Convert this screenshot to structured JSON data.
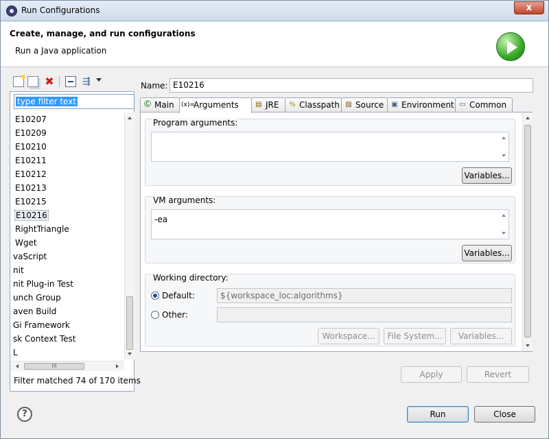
{
  "window": {
    "title": "Run Configurations",
    "close_label": "x"
  },
  "header": {
    "title": "Create, manage, and run configurations",
    "subtitle": "Run a Java application",
    "badge_icon": "run-play-icon"
  },
  "left": {
    "toolbar_icons": [
      "new-config-icon",
      "duplicate-config-icon",
      "delete-config-icon",
      "collapse-all-icon",
      "filter-icon",
      "dropdown-arrow-icon"
    ],
    "delete_glyph": "✖",
    "filter_glyph": "⇶",
    "filter_placeholder": "type filter text",
    "items": [
      {
        "label": "E10207"
      },
      {
        "label": "E10209"
      },
      {
        "label": "E10210"
      },
      {
        "label": "E10211"
      },
      {
        "label": "E10212"
      },
      {
        "label": "E10213"
      },
      {
        "label": "E10215"
      },
      {
        "label": "E10216",
        "selected": true
      },
      {
        "label": "RightTriangle"
      },
      {
        "label": "Wget"
      },
      {
        "label": "vaScript"
      },
      {
        "label": "nit"
      },
      {
        "label": "nit Plug-in Test"
      },
      {
        "label": "unch Group"
      },
      {
        "label": "aven Build"
      },
      {
        "label": "Gi Framework"
      },
      {
        "label": "sk Context Test"
      },
      {
        "label": "L"
      }
    ],
    "hscroll_grip": "III",
    "status": "Filter matched 74 of 170 items"
  },
  "right": {
    "name_label": "Name:",
    "name_value": "E10216",
    "tabs": [
      {
        "label": "Main",
        "icon": "main-tab-icon",
        "glyph": "Ⓒ"
      },
      {
        "label": "Arguments",
        "icon": "arguments-tab-icon",
        "glyph": "(x)="
      },
      {
        "label": "JRE",
        "icon": "jre-tab-icon",
        "glyph": "▤"
      },
      {
        "label": "Classpath",
        "icon": "classpath-tab-icon",
        "glyph": "%"
      },
      {
        "label": "Source",
        "icon": "source-tab-icon",
        "glyph": "▧"
      },
      {
        "label": "Environment",
        "icon": "environment-tab-icon",
        "glyph": "▣"
      },
      {
        "label": "Common",
        "icon": "common-tab-icon",
        "glyph": "▭"
      }
    ],
    "program_args": {
      "label": "Program arguments:",
      "value": "",
      "variables": "Variables..."
    },
    "vm_args": {
      "label": "VM arguments:",
      "value": "-ea",
      "variables": "Variables..."
    },
    "working_dir": {
      "label": "Working directory:",
      "default_label": "Default:",
      "default_value": "${workspace_loc:algorithms}",
      "other_label": "Other:",
      "other_value": "",
      "workspace_btn": "Workspace...",
      "filesystem_btn": "File System...",
      "variables_btn": "Variables..."
    },
    "apply": "Apply",
    "revert": "Revert"
  },
  "footer": {
    "help": "?",
    "run": "Run",
    "close": "Close"
  }
}
